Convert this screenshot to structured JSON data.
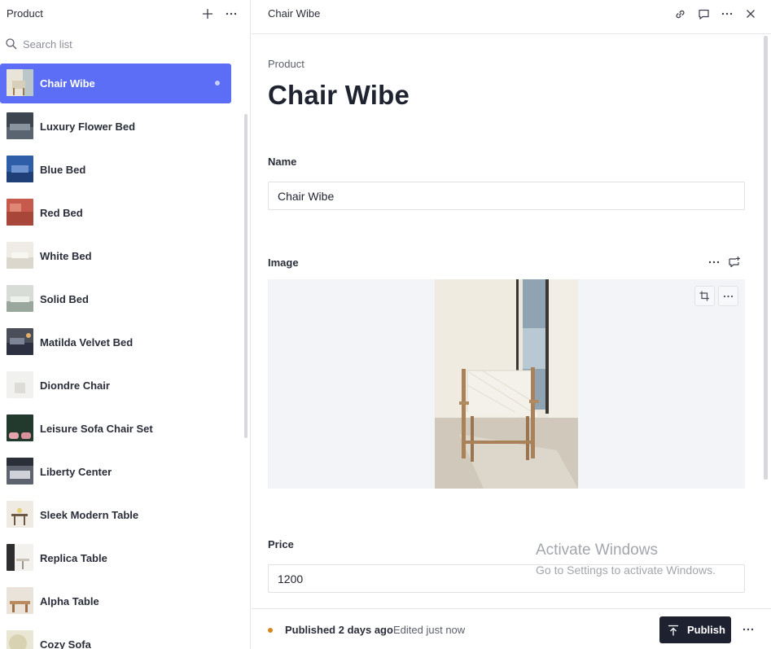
{
  "left": {
    "title": "Product",
    "add_icon": "plus-icon",
    "more_icon": "ellipsis-icon",
    "search": {
      "placeholder": "Search list",
      "value": ""
    },
    "items": [
      {
        "label": "Chair Wibe",
        "selected": true
      },
      {
        "label": "Luxury Flower Bed"
      },
      {
        "label": "Blue Bed"
      },
      {
        "label": "Red Bed"
      },
      {
        "label": "White Bed"
      },
      {
        "label": "Solid Bed"
      },
      {
        "label": "Matilda Velvet Bed"
      },
      {
        "label": "Diondre Chair"
      },
      {
        "label": "Leisure Sofa Chair Set"
      },
      {
        "label": "Liberty Center"
      },
      {
        "label": "Sleek Modern Table"
      },
      {
        "label": "Replica Table"
      },
      {
        "label": "Alpha Table"
      },
      {
        "label": "Cozy Sofa"
      }
    ]
  },
  "right": {
    "header_title": "Chair Wibe",
    "header_icons": [
      "link-icon",
      "comment-icon",
      "ellipsis-icon",
      "close-icon"
    ],
    "eyebrow": "Product",
    "heading": "Chair Wibe",
    "fields": {
      "name": {
        "label": "Name",
        "value": "Chair Wibe"
      },
      "image": {
        "label": "Image"
      },
      "price": {
        "label": "Price",
        "value": "1200"
      }
    }
  },
  "footer": {
    "status": "Published 2 days ago",
    "edited": "Edited just now",
    "publish_label": "Publish"
  },
  "watermark": {
    "title": "Activate Windows",
    "subtitle": "Go to Settings to activate Windows."
  },
  "colors": {
    "accent": "#5b6ef5",
    "publish_bg": "#1e2230",
    "status_dot": "#d9861d"
  }
}
